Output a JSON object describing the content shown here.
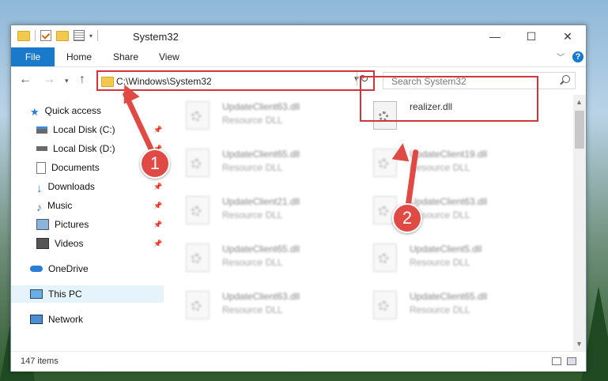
{
  "window": {
    "title": "System32",
    "minimize": "—",
    "maximize": "☐",
    "close": "✕"
  },
  "ribbon": {
    "tabs": [
      "File",
      "Home",
      "Share",
      "View"
    ],
    "help": "?"
  },
  "address": {
    "path": "C:\\Windows\\System32",
    "search_placeholder": "Search System32"
  },
  "nav": {
    "items": [
      {
        "label": "Quick access",
        "icon": "star-icon"
      },
      {
        "label": "Local Disk (C:)",
        "icon": "drive-icon",
        "pinned": true
      },
      {
        "label": "Local Disk (D:)",
        "icon": "drive-icon",
        "pinned": true
      },
      {
        "label": "Documents",
        "icon": "documents-icon",
        "pinned": true
      },
      {
        "label": "Downloads",
        "icon": "download-icon",
        "pinned": true
      },
      {
        "label": "Music",
        "icon": "music-icon",
        "pinned": true
      },
      {
        "label": "Pictures",
        "icon": "pictures-icon",
        "pinned": true
      },
      {
        "label": "Videos",
        "icon": "videos-icon",
        "pinned": true
      },
      {
        "label": "OneDrive",
        "icon": "cloud-icon"
      },
      {
        "label": "This PC",
        "icon": "pc-icon",
        "selected": true
      },
      {
        "label": "Network",
        "icon": "network-icon"
      }
    ]
  },
  "files": {
    "left_column": [
      {
        "name": "UpdateClient63.dll",
        "type": "Resource DLL"
      },
      {
        "name": "UpdateClient65.dll",
        "type": "Resource DLL"
      },
      {
        "name": "UpdateClient21.dll",
        "type": "Resource DLL"
      },
      {
        "name": "UpdateClient65.dll",
        "type": "Resource DLL"
      },
      {
        "name": "UpdateClient63.dll",
        "type": "Resource DLL"
      }
    ],
    "right_column": [
      {
        "name": "realizer.dll",
        "type": ""
      },
      {
        "name": "UpdateClient19.dll",
        "type": "Resource DLL"
      },
      {
        "name": "UpdateClient63.dll",
        "type": "Resource DLL"
      },
      {
        "name": "UpdateClient5.dll",
        "type": "Resource DLL"
      },
      {
        "name": "UpdateClient65.dll",
        "type": "Resource DLL"
      }
    ]
  },
  "status": {
    "item_count": "147 items"
  },
  "callouts": {
    "one": "1",
    "two": "2"
  },
  "colors": {
    "accent": "#1979ca",
    "highlight": "#d0363a",
    "callout": "#e04a44"
  }
}
